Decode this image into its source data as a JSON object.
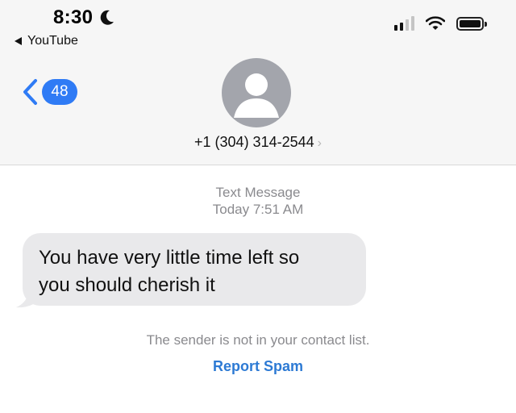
{
  "status_bar": {
    "time": "8:30",
    "back_app_label": "YouTube"
  },
  "nav": {
    "unread_count": "48"
  },
  "contact": {
    "phone_number": "+1 (304) 314-2544",
    "arrow": "›"
  },
  "thread": {
    "message_type": "Text Message",
    "timestamp": "Today 7:51 AM",
    "message_line_1": "You have very little time left so",
    "message_line_2": "you should cherish it"
  },
  "footer": {
    "notice": "The sender is not in your contact list.",
    "report_spam": "Report Spam"
  },
  "colors": {
    "accent": "#2f7bf5",
    "link": "#2d7ad4",
    "bubble": "#e9e9eb",
    "avatar": "#a3a5ac"
  },
  "icons": [
    "moon-icon",
    "back-triangle-icon",
    "signal-icon",
    "wifi-icon",
    "battery-icon",
    "chevron-left-icon",
    "person-icon",
    "chevron-right-icon"
  ]
}
